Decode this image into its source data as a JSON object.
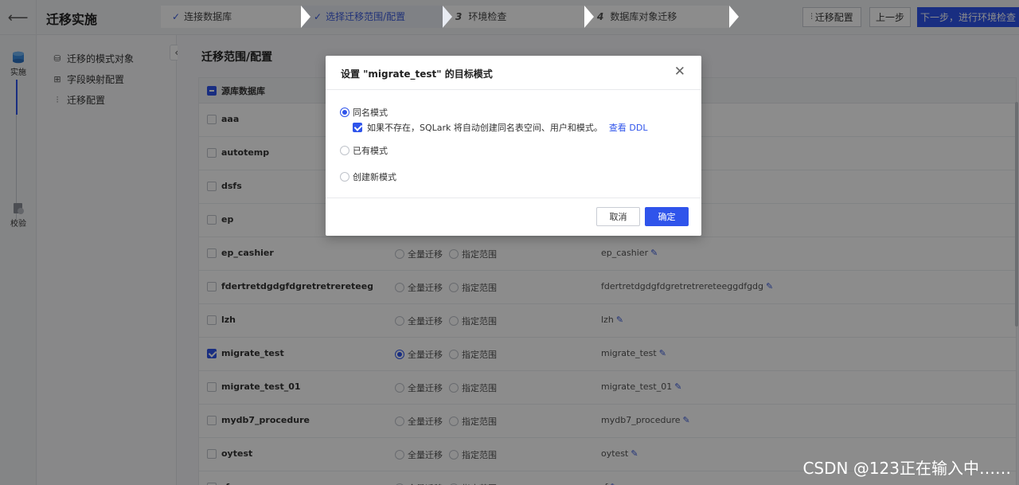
{
  "header": {
    "back_icon": "arrow-left-icon",
    "title": "迁移实施",
    "steps": [
      {
        "num": "",
        "done": true,
        "label": "连接数据库"
      },
      {
        "num": "",
        "done": true,
        "label": "选择迁移范围/配置"
      },
      {
        "num": "3",
        "done": false,
        "label": "环境检查"
      },
      {
        "num": "4",
        "done": false,
        "label": "数据库对象迁移"
      }
    ],
    "migrate_config_label": "迁移配置",
    "prev_label": "上一步",
    "next_label": "下一步，进行环境检查"
  },
  "rail": {
    "items": [
      {
        "label": "实施",
        "icon": "database-icon"
      },
      {
        "label": "校验",
        "icon": "verify-icon"
      }
    ]
  },
  "sidebar": {
    "items": [
      {
        "label": "迁移的模式对象",
        "icon": "database-icon"
      },
      {
        "label": "字段映射配置",
        "icon": "field-map-icon"
      },
      {
        "label": "迁移配置",
        "icon": "sliders-icon"
      }
    ]
  },
  "main": {
    "title": "迁移范围/配置",
    "table_header": "源库数据库",
    "radio_full": "全量迁移",
    "radio_range": "指定范围",
    "rows": [
      {
        "name": "aaa",
        "checked": false,
        "radios": false,
        "full": false,
        "target": ""
      },
      {
        "name": "autotemp",
        "checked": false,
        "radios": false,
        "full": false,
        "target": ""
      },
      {
        "name": "dsfs",
        "checked": false,
        "radios": false,
        "full": false,
        "target": ""
      },
      {
        "name": "ep",
        "checked": false,
        "radios": false,
        "full": false,
        "target": ""
      },
      {
        "name": "ep_cashier",
        "checked": false,
        "radios": true,
        "full": false,
        "target": "ep_cashier"
      },
      {
        "name": "fdertretdgdgfdgretretrereteeggdfg...",
        "checked": false,
        "radios": true,
        "full": false,
        "target": "fdertretdgdgfdgretretrereteeggdfgdg"
      },
      {
        "name": "lzh",
        "checked": false,
        "radios": true,
        "full": false,
        "target": "lzh"
      },
      {
        "name": "migrate_test",
        "checked": true,
        "radios": true,
        "full": true,
        "target": "migrate_test"
      },
      {
        "name": "migrate_test_01",
        "checked": false,
        "radios": true,
        "full": false,
        "target": "migrate_test_01"
      },
      {
        "name": "mydb7_procedure",
        "checked": false,
        "radios": true,
        "full": false,
        "target": "mydb7_procedure"
      },
      {
        "name": "oytest",
        "checked": false,
        "radios": true,
        "full": false,
        "target": "oytest"
      },
      {
        "name": "rf",
        "checked": false,
        "radios": true,
        "full": false,
        "target": "rf"
      }
    ]
  },
  "modal": {
    "title": "设置 \"migrate_test\" 的目标模式",
    "options": [
      {
        "label": "同名模式",
        "selected": true
      },
      {
        "label": "已有模式",
        "selected": false
      },
      {
        "label": "创建新模式",
        "selected": false
      }
    ],
    "auto_create_text": "如果不存在，SQLark 将自动创建同名表空间、用户和模式。",
    "auto_create_checked": true,
    "view_ddl_label": "查看 DDL",
    "cancel_label": "取消",
    "ok_label": "确定"
  },
  "watermark": "CSDN @123正在输入中……"
}
